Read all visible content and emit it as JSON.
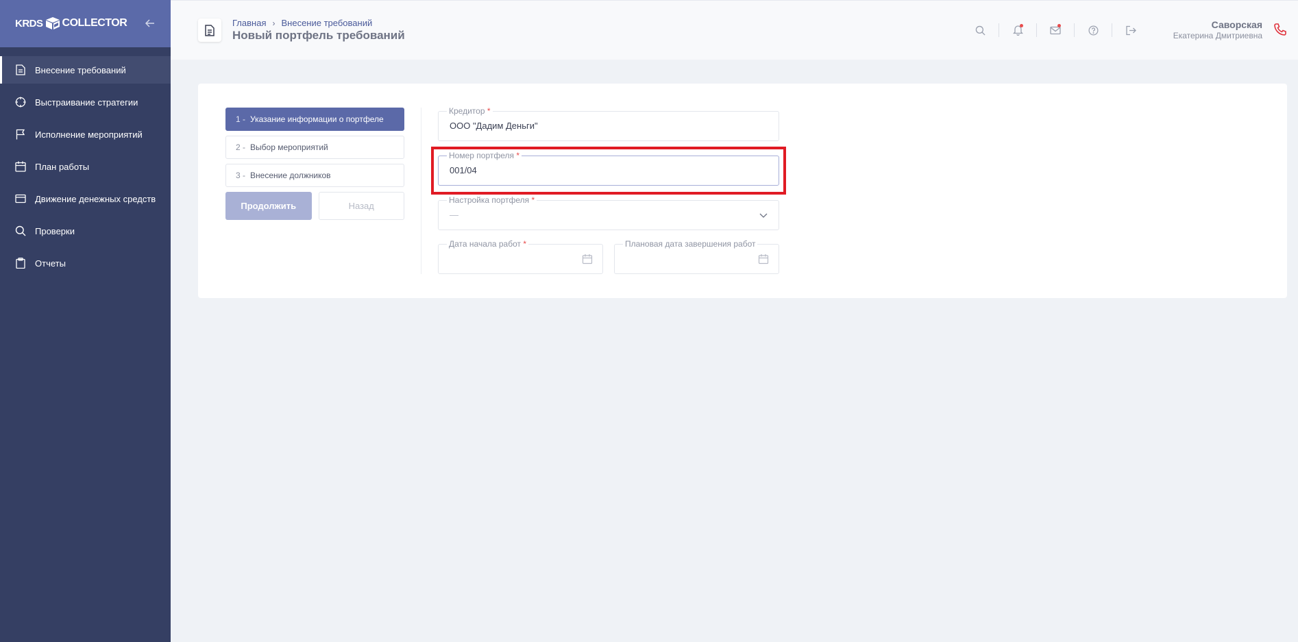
{
  "app": {
    "logo_left": "KRDS",
    "logo_right": "COLLECTOR"
  },
  "sidebar": {
    "items": [
      {
        "label": "Внесение требований",
        "icon": "document-icon",
        "active": true
      },
      {
        "label": "Выстраивание стратегии",
        "icon": "crosshair-icon",
        "active": false
      },
      {
        "label": "Исполнение мероприятий",
        "icon": "flag-icon",
        "active": false
      },
      {
        "label": "План работы",
        "icon": "calendar-icon",
        "active": false
      },
      {
        "label": "Движение денежных средств",
        "icon": "credit-card-icon",
        "active": false
      },
      {
        "label": "Проверки",
        "icon": "search-icon",
        "active": false
      },
      {
        "label": "Отчеты",
        "icon": "clipboard-icon",
        "active": false
      }
    ]
  },
  "header": {
    "breadcrumb": [
      "Главная",
      "Внесение требований"
    ],
    "title": "Новый портфель требований",
    "icons": [
      "search-icon",
      "bell-icon",
      "mail-icon",
      "help-icon",
      "logout-icon"
    ],
    "user": {
      "last_name": "Саворская",
      "first_name": "Екатерина Дмитриевна"
    }
  },
  "steps": [
    {
      "num": "1 -",
      "label": "Указание информации о портфеле",
      "active": true
    },
    {
      "num": "2 -",
      "label": "Выбор мероприятий",
      "active": false
    },
    {
      "num": "3 -",
      "label": "Внесение должников",
      "active": false
    }
  ],
  "buttons": {
    "continue": "Продолжить",
    "back": "Назад"
  },
  "form": {
    "creditor": {
      "label": "Кредитор",
      "required": "*",
      "value": "ООО \"Дадим Деньги\""
    },
    "portfolio_number": {
      "label": "Номер портфеля",
      "required": "*",
      "value": "001/04"
    },
    "portfolio_settings": {
      "label": "Настройка портфеля",
      "required": "*",
      "value": "—"
    },
    "start_date": {
      "label": "Дата начала работ",
      "required": "*",
      "value": ""
    },
    "planned_end_date": {
      "label": "Плановая дата завершения работ",
      "value": ""
    }
  },
  "colors": {
    "sidebar_bg": "#353f63",
    "accent": "#5b69a8",
    "highlight": "#e01b24",
    "required": "#e84b4b"
  }
}
